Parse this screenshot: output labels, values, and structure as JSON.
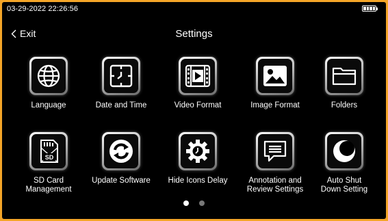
{
  "status": {
    "datetime": "03-29-2022 22:26:56"
  },
  "header": {
    "back_label": "Exit",
    "title": "Settings"
  },
  "tiles": [
    {
      "label": "Language",
      "icon": "globe-icon"
    },
    {
      "label": "Date and Time",
      "icon": "clock-icon"
    },
    {
      "label": "Video Format",
      "icon": "video-play-icon"
    },
    {
      "label": "Image Format",
      "icon": "image-icon"
    },
    {
      "label": "Folders",
      "icon": "folder-icon"
    },
    {
      "label": "SD Card\nManagement",
      "icon": "sd-card-icon"
    },
    {
      "label": "Update Software",
      "icon": "refresh-icon"
    },
    {
      "label": "Hide Icons Delay",
      "icon": "gear-clock-icon"
    },
    {
      "label": "Annotation and\nReview Settings",
      "icon": "speech-bubble-icon"
    },
    {
      "label": "Auto Shut\nDown Setting",
      "icon": "moon-icon"
    }
  ],
  "pagination": {
    "pages": 2,
    "current": 1
  },
  "colors": {
    "frame": "#f4a528",
    "screen": "#000000",
    "dot_inactive": "#777777"
  }
}
